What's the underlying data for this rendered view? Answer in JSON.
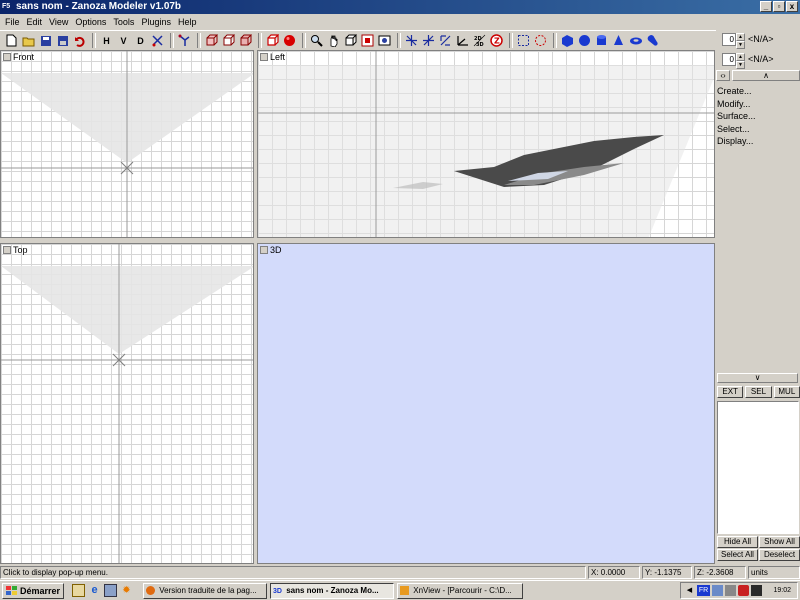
{
  "window": {
    "app_icon": "F5",
    "title": "sans nom - Zanoza Modeler v1.07b",
    "buttons": [
      "_",
      "▫",
      "x"
    ]
  },
  "menu": [
    "File",
    "Edit",
    "View",
    "Options",
    "Tools",
    "Plugins",
    "Help"
  ],
  "toolbar": {
    "view_letters": [
      "H",
      "V",
      "D"
    ],
    "icons": [
      "new-file-icon",
      "open-folder-icon",
      "save-icon",
      "save-as-icon",
      "undo-icon",
      "scissors-icon",
      "tree-icon",
      "box-front-icon",
      "box-side-icon",
      "box-top-icon",
      "box-red-icon",
      "sphere-red-icon",
      "magnify-icon",
      "hand-icon",
      "rotate-cube-icon",
      "fit-view-icon",
      "render-icon",
      "move-icon",
      "scale-icon",
      "rotate-icon",
      "axis-icon",
      "2d3d-icon",
      "z-icon",
      "select-rect-icon",
      "select-circle-icon",
      "cube-blue-icon",
      "sphere-blue-icon",
      "cylinder-blue-icon",
      "cone-blue-icon",
      "torus-blue-icon",
      "tube-blue-icon"
    ],
    "label_2d3d": "2D\n3D",
    "label_z": "Z"
  },
  "viewports": {
    "front": {
      "label": "Front"
    },
    "left": {
      "label": "Left"
    },
    "top": {
      "label": "Top"
    },
    "view3d": {
      "label": "3D"
    }
  },
  "right_panel": {
    "spinners": [
      {
        "value": "0",
        "text": "<N/A>"
      },
      {
        "value": "0",
        "text": "<N/A>"
      }
    ],
    "commands": [
      "Create...",
      "Modify...",
      "Surface...",
      "Select...",
      "Display..."
    ],
    "mode_buttons": [
      "EXT",
      "SEL",
      "MUL"
    ],
    "hide_all": "Hide All",
    "show_all": "Show All",
    "select_all": "Select All",
    "deselect": "Deselect"
  },
  "status": {
    "hint": "Click to display pop-up menu.",
    "x": "X: 0.0000",
    "y": "Y: -1.1375",
    "z": "Z: -2.3608",
    "units": "units"
  },
  "taskbar": {
    "start": "Démarrer",
    "tasks": [
      {
        "label": "Version traduite de la pag...",
        "active": false
      },
      {
        "label": "sans nom - Zanoza Mo...",
        "active": true
      },
      {
        "label": "XnView - [Parcourir - C:\\D...",
        "active": false
      }
    ],
    "tray_lang": "FR",
    "clock": "19:02"
  },
  "colors": {
    "title_bar": "#0a246a",
    "window_bg": "#d4d0c8",
    "view3d_bg": "#d3dbfb",
    "grid_line": "#d6d6d6"
  }
}
